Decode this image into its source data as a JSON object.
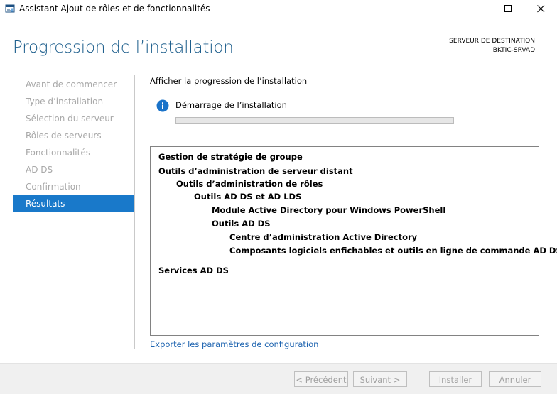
{
  "window": {
    "title": "Assistant Ajout de rôles et de fonctionnalités"
  },
  "header": {
    "page_title": "Progression de l’installation",
    "destination_label": "SERVEUR DE DESTINATION",
    "destination_server": "BKTIC-SRVAD"
  },
  "sidebar": {
    "items": [
      {
        "label": "Avant de commencer",
        "active": false
      },
      {
        "label": "Type d’installation",
        "active": false
      },
      {
        "label": "Sélection du serveur",
        "active": false
      },
      {
        "label": "Rôles de serveurs",
        "active": false
      },
      {
        "label": "Fonctionnalités",
        "active": false
      },
      {
        "label": "AD DS",
        "active": false
      },
      {
        "label": "Confirmation",
        "active": false
      },
      {
        "label": "Résultats",
        "active": true
      }
    ]
  },
  "main": {
    "subtitle": "Afficher la progression de l’installation",
    "status_text": "Démarrage de l’installation",
    "progress_percent": 0,
    "results": [
      {
        "text": "Gestion de stratégie de groupe",
        "level": 0
      },
      {
        "text": "Outils d’administration de serveur distant",
        "level": 0
      },
      {
        "text": "Outils d’administration de rôles",
        "level": 1
      },
      {
        "text": "Outils AD DS et AD LDS",
        "level": 2
      },
      {
        "text": "Module Active Directory pour Windows PowerShell",
        "level": 3
      },
      {
        "text": "Outils AD DS",
        "level": 3
      },
      {
        "text": "Centre d’administration Active Directory",
        "level": 4
      },
      {
        "text": "Composants logiciels enfichables et outils en ligne de commande AD DS",
        "level": 4
      },
      {
        "text": "",
        "level": 0
      },
      {
        "text": "Services AD DS",
        "level": 0
      }
    ],
    "export_link": "Exporter les paramètres de configuration"
  },
  "footer": {
    "prev_label": "< Précédent",
    "next_label": "Suivant >",
    "install_label": "Installer",
    "cancel_label": "Annuler"
  },
  "colors": {
    "accent": "#1979ca",
    "title": "#1d5e8c",
    "link": "#1e64b0",
    "info_icon": "#1a73c9"
  },
  "icons": {
    "app": "server-manager-icon",
    "info": "info-icon"
  }
}
